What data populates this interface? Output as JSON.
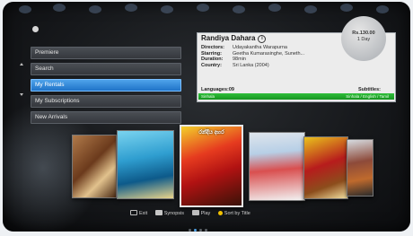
{
  "menu": {
    "items": [
      {
        "label": "Premiere",
        "active": false
      },
      {
        "label": "Search",
        "active": false
      },
      {
        "label": "My Rentals",
        "active": true
      },
      {
        "label": "My Subscriptions",
        "active": false
      },
      {
        "label": "New Arrivals",
        "active": false
      }
    ]
  },
  "details": {
    "title": "Randiya Dahara",
    "info_icon": "i",
    "rows": [
      {
        "label": "Directors:",
        "value": "Udayakantha Warapurna"
      },
      {
        "label": "Starring:",
        "value": "Geetha Kumarasinghe, Suneth..."
      },
      {
        "label": "Duration:",
        "value": "98min"
      },
      {
        "label": "Country:",
        "value": "Sri Lanka (2004)"
      }
    ],
    "languages_label": "Languages:09",
    "subtitles_label": "Subtitles:",
    "bar_left": "Sinhala",
    "bar_right": "Sinhala / English / Tamil",
    "badge_price": "Rs.130.00",
    "badge_days": "1 Day"
  },
  "posters": [
    {
      "title": ""
    },
    {
      "title": ""
    },
    {
      "title": "රන්දිය දහර"
    },
    {
      "title": ""
    },
    {
      "title": ""
    },
    {
      "title": ""
    }
  ],
  "footer": {
    "exit": "Exit",
    "synopsis": "Synopsis",
    "play": "Play",
    "sort": "Sort by Title"
  },
  "colors": {
    "selection_blue": "#2a86dc",
    "language_bar_green": "#23a82e",
    "sort_key_yellow": "#f2c200"
  },
  "icons": {
    "exit": "return-arrow-icon",
    "synopsis": "info-key-icon",
    "play": "play-key-icon",
    "sort": "yellow-dot-icon"
  }
}
